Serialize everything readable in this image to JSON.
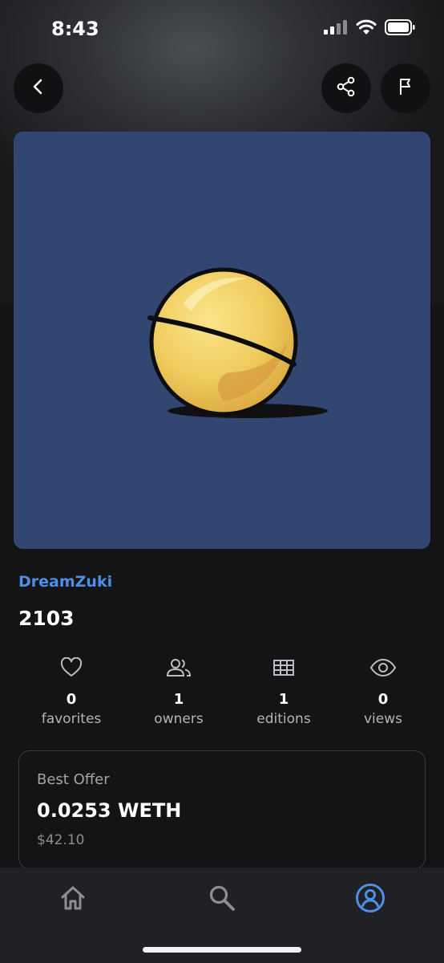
{
  "status_bar": {
    "time": "8:43",
    "icons": [
      "signal-icon",
      "wifi-icon",
      "battery-icon"
    ]
  },
  "header": {
    "buttons": [
      "back-icon",
      "share-icon",
      "flag-icon"
    ]
  },
  "artwork": {
    "background": "#324671",
    "subject": "ball-icon"
  },
  "nft": {
    "collection": "DreamZuki",
    "name": "2103"
  },
  "stats": [
    {
      "icon": "heart-icon",
      "value": "0",
      "label": "favorites"
    },
    {
      "icon": "owners-icon",
      "value": "1",
      "label": "owners"
    },
    {
      "icon": "grid-icon",
      "value": "1",
      "label": "editions"
    },
    {
      "icon": "eye-icon",
      "value": "0",
      "label": "views"
    }
  ],
  "offer": {
    "label": "Best Offer",
    "value": "0.0253 WETH",
    "usd": "$42.10"
  },
  "tabs": [
    {
      "icon": "home-icon",
      "active": false
    },
    {
      "icon": "search-icon",
      "active": false
    },
    {
      "icon": "profile-icon",
      "active": true
    }
  ],
  "colors": {
    "accent": "#4e8fe6",
    "artwork_bg": "#324671",
    "inactive_icon": "#8e8e92"
  }
}
